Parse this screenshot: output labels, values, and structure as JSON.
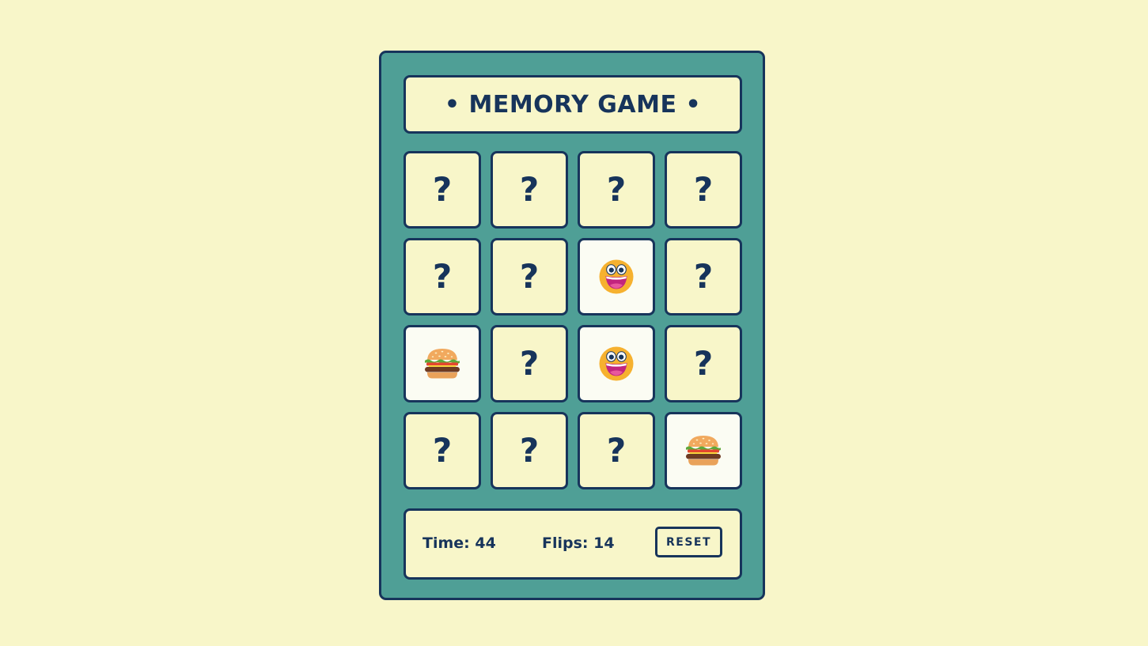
{
  "game": {
    "title": "• MEMORY GAME •",
    "hidden_symbol": "?",
    "cards": [
      {
        "state": "hidden",
        "face": null
      },
      {
        "state": "hidden",
        "face": null
      },
      {
        "state": "hidden",
        "face": null
      },
      {
        "state": "hidden",
        "face": null
      },
      {
        "state": "hidden",
        "face": null
      },
      {
        "state": "hidden",
        "face": null
      },
      {
        "state": "revealed",
        "face": "grinning-face"
      },
      {
        "state": "hidden",
        "face": null
      },
      {
        "state": "revealed",
        "face": "hamburger"
      },
      {
        "state": "hidden",
        "face": null
      },
      {
        "state": "revealed",
        "face": "grinning-face"
      },
      {
        "state": "hidden",
        "face": null
      },
      {
        "state": "hidden",
        "face": null
      },
      {
        "state": "hidden",
        "face": null
      },
      {
        "state": "hidden",
        "face": null
      },
      {
        "state": "revealed",
        "face": "hamburger"
      }
    ]
  },
  "footer": {
    "time_label": "Time: 44",
    "flips_label": "Flips: 14",
    "reset_label": "RESET"
  },
  "colors": {
    "page_background": "#f8f6c9",
    "board_background": "#4f9f96",
    "outline": "#17345b",
    "card_back": "#f8f6c9",
    "card_face": "#fbfcf3"
  }
}
